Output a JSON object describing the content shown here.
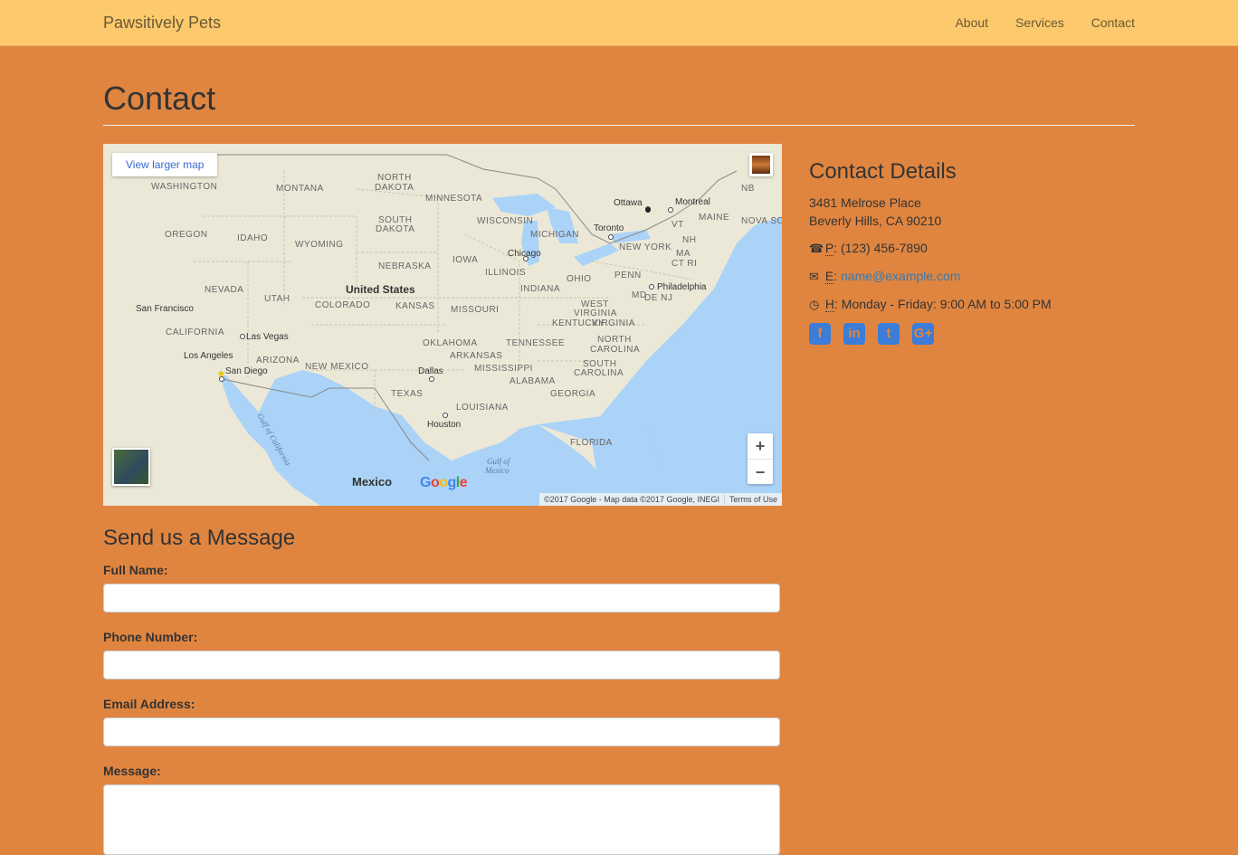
{
  "nav": {
    "brand": "Pawsitively Pets",
    "links": [
      "About",
      "Services",
      "Contact"
    ]
  },
  "page": {
    "title": "Contact"
  },
  "map": {
    "larger_map_label": "View larger map",
    "zoom_in": "+",
    "zoom_out": "−",
    "google_logo": [
      "G",
      "o",
      "o",
      "g",
      "l",
      "e"
    ],
    "attribution": "©2017 Google - Map data ©2017 Google, INEGI",
    "terms": "Terms of Use",
    "labels": {
      "washington": "WASHINGTON",
      "montana": "MONTANA",
      "north_dakota_1": "NORTH",
      "north_dakota_2": "DAKOTA",
      "minnesota": "MINNESOTA",
      "oregon": "OREGON",
      "idaho": "IDAHO",
      "south_dakota_1": "SOUTH",
      "south_dakota_2": "DAKOTA",
      "wisconsin": "WISCONSIN",
      "wyoming": "WYOMING",
      "michigan": "MICHIGAN",
      "iowa": "IOWA",
      "nebraska": "NEBRASKA",
      "nevada": "NEVADA",
      "utah": "UTAH",
      "united_states": "United States",
      "illinois": "ILLINOIS",
      "indiana": "INDIANA",
      "ohio": "OHIO",
      "penn": "PENN",
      "colorado": "COLORADO",
      "kansas": "KANSAS",
      "missouri": "MISSOURI",
      "west_virginia_1": "WEST",
      "west_virginia_2": "VIRGINIA",
      "california": "CALIFORNIA",
      "kentucky": "KENTUCKY",
      "virginia": "VIRGINIA",
      "oklahoma": "OKLAHOMA",
      "tennessee": "TENNESSEE",
      "north_carolina_1": "NORTH",
      "north_carolina_2": "CAROLINA",
      "arizona": "ARIZONA",
      "new_mexico": "NEW MEXICO",
      "arkansas": "ARKANSAS",
      "mississippi": "MISSISSIPPI",
      "south_carolina_1": "SOUTH",
      "south_carolina_2": "CAROLINA",
      "alabama": "ALABAMA",
      "georgia": "GEORGIA",
      "texas": "TEXAS",
      "louisiana": "LOUISIANA",
      "florida": "FLORIDA",
      "new_york": "NEW YORK",
      "vt": "VT",
      "nh": "NH",
      "ma": "MA",
      "ct_ri": "CT RI",
      "md": "MD",
      "dej": "DE NJ",
      "maine": "MAINE",
      "nb": "NB",
      "nova": "NOVA SC",
      "mexico": "Mexico",
      "gulf_mexico_1": "Gulf of",
      "gulf_mexico_2": "Mexico",
      "gulf_california": "Gulf of California",
      "seattle": "",
      "san_francisco": "San Francisco",
      "las_vegas": "Las Vegas",
      "los_angeles": "Los Angeles",
      "san_diego": "San Diego",
      "chicago": "Chicago",
      "dallas": "Dallas",
      "houston": "Houston",
      "toronto": "Toronto",
      "ottawa": "Ottawa",
      "montreal": "Montreal",
      "philadelphia": "Philadelphia"
    }
  },
  "details": {
    "title": "Contact Details",
    "address_line1": "3481 Melrose Place",
    "address_line2": "Beverly Hills, CA 90210",
    "phone_label": "P",
    "phone": "(123) 456-7890",
    "email_label": "E",
    "email": "name@example.com",
    "hours_label": "H",
    "hours": "Monday - Friday: 9:00 AM to 5:00 PM",
    "socials": [
      "facebook",
      "linkedin",
      "twitter",
      "google-plus"
    ]
  },
  "form": {
    "title": "Send us a Message",
    "full_name_label": "Full Name:",
    "phone_label": "Phone Number:",
    "email_label": "Email Address:",
    "message_label": "Message:"
  }
}
